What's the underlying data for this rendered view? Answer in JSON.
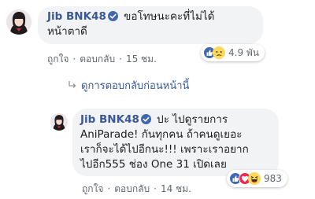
{
  "comment_1": {
    "author": "Jib BNK48",
    "text_line_1": "ขอโทษนะคะที่ไม่ได้",
    "text_line_2": "หน้าตาดี",
    "like_label": "ถูกใจ",
    "reply_label": "ตอบกลับ",
    "separator": "·",
    "timestamp": "15 ชม.",
    "reaction_count": "4.9 พัน",
    "reaction_icons": [
      "like-icon",
      "sad-icon"
    ]
  },
  "view_previous_replies": {
    "label": "ดูการตอบกลับก่อนหน้านี้",
    "icon": "reply-arrow-icon"
  },
  "comment_2": {
    "author": "Jib BNK48",
    "text_line_1": "ปะ ไปดูรายการ",
    "text_line_2": "AniParade! กันทุกคน ถ้าคนดูเยอะ",
    "text_line_3": "เราก็จะได้ไปอีกนะ!!! เพราะเราอยาก",
    "text_line_4": "ไปอีก555 ช่อง One 31 เปิดเลย",
    "like_label": "ถูกใจ",
    "reply_label": "ตอบกลับ",
    "separator": "·",
    "timestamp": "14 ชม.",
    "reaction_count": "983",
    "reaction_icons": [
      "like-icon",
      "love-icon",
      "haha-icon"
    ]
  },
  "colors": {
    "author_link": "#385898",
    "bubble_bg": "#f2f3f5",
    "meta_text": "#606770",
    "like_blue": "#4267b2",
    "love_red": "#f0284a",
    "reaction_yellow": "#fcd95b"
  }
}
